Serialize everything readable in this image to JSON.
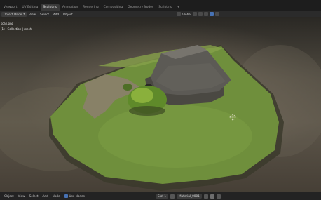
{
  "workspace_tabs": [
    {
      "label": "Viewport",
      "active": false
    },
    {
      "label": "UV Editing",
      "active": false
    },
    {
      "label": "Sculpting",
      "active": true
    },
    {
      "label": "Animation",
      "active": false
    },
    {
      "label": "Rendering",
      "active": false
    },
    {
      "label": "Compositing",
      "active": false
    },
    {
      "label": "Geometry Nodes",
      "active": false
    },
    {
      "label": "Scripting",
      "active": false
    },
    {
      "label": "+",
      "active": false
    }
  ],
  "viewport_header": {
    "mode": "Object Mode",
    "menus": [
      "View",
      "Select",
      "Add",
      "Object"
    ],
    "orientation": "Global"
  },
  "viewport_overlay": {
    "line1": "scan.png",
    "line2": "(1) | Collection | mesh"
  },
  "bottom_bar": {
    "left_items": [
      "Object",
      "View",
      "Select",
      "Add",
      "Node"
    ],
    "use_nodes_label": "Use Nodes",
    "slot_label": "Slot 1",
    "material_name": "Material_0001"
  },
  "colors": {
    "active_tab_bg": "#3a3a3a",
    "accent_blue": "#4772b3",
    "header_bg": "#2b2b2b",
    "grass": "#6f8f3c",
    "roof": "#5c5a55"
  }
}
